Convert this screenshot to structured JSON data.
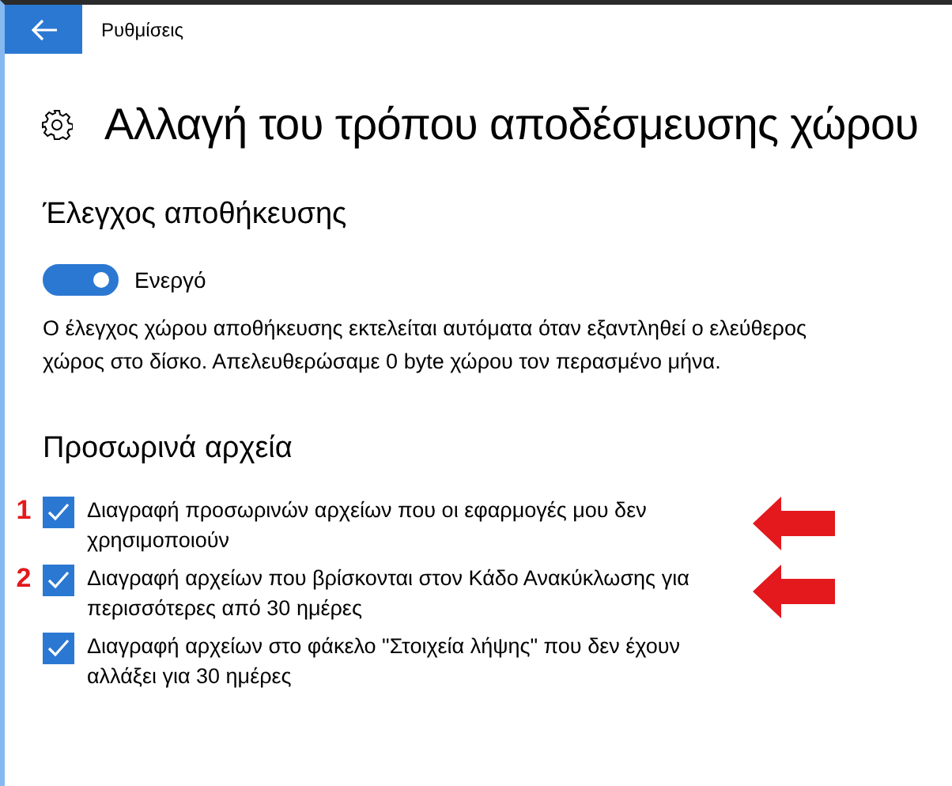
{
  "window": {
    "title": "Ρυθμίσεις"
  },
  "page_title": "Αλλαγή του τρόπου αποδέσμευσης χώρου",
  "storage_sense": {
    "heading": "Έλεγχος αποθήκευσης",
    "toggle": {
      "on": true,
      "label": "Ενεργό"
    },
    "description": "Ο έλεγχος χώρου αποθήκευσης εκτελείται αυτόματα όταν εξαντληθεί ο ελεύθερος χώρος στο δίσκο. Απελευθερώσαμε 0 byte χώρου τον περασμένο μήνα."
  },
  "temp_files": {
    "heading": "Προσωρινά αρχεία",
    "options": [
      {
        "label": "Διαγραφή προσωρινών αρχείων που οι εφαρμογές μου δεν χρησιμοποιούν",
        "checked": true,
        "marker": "1",
        "arrow": true
      },
      {
        "label": "Διαγραφή αρχείων που βρίσκονται στον Κάδο Ανακύκλωσης για περισσότερες από 30 ημέρες",
        "checked": true,
        "marker": "2",
        "arrow": true
      },
      {
        "label": "Διαγραφή αρχείων στο φάκελο \"Στοιχεία λήψης\" που δεν έχουν αλλάξει για 30 ημέρες",
        "checked": true,
        "arrow": false
      }
    ]
  }
}
